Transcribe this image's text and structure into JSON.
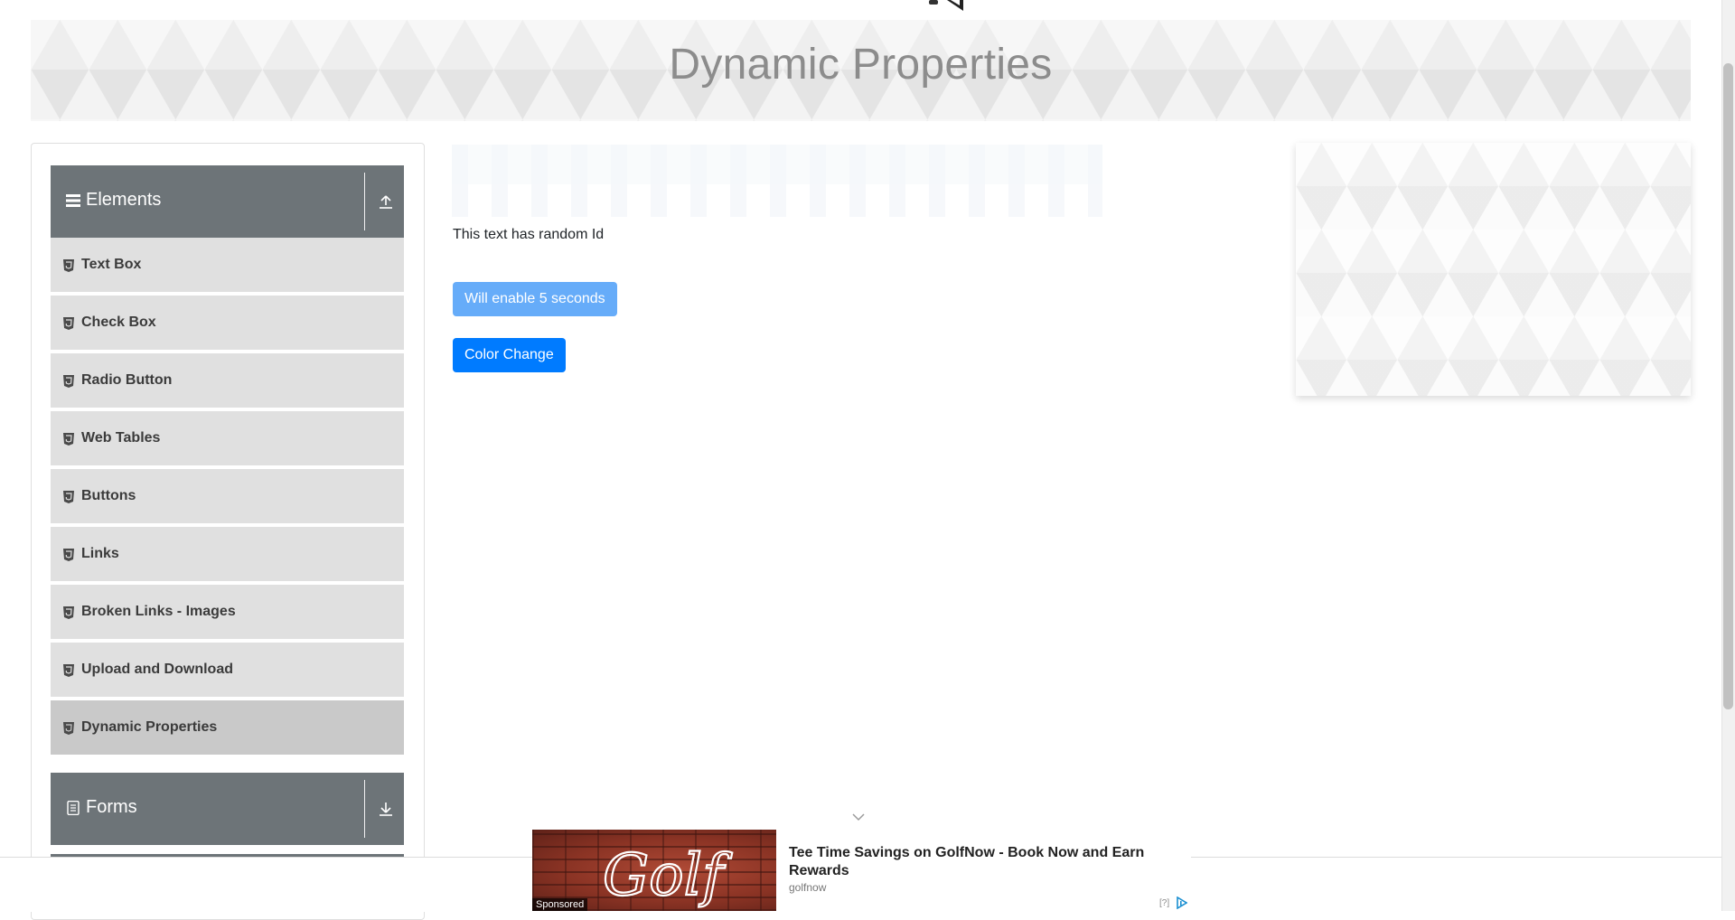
{
  "page": {
    "title": "Dynamic Properties"
  },
  "sidebar": {
    "groups": [
      {
        "label": "Elements",
        "icon": "hamburger-icon",
        "toggle_icon": "collapse-up-icon"
      },
      {
        "label": "Forms",
        "icon": "document-icon",
        "toggle_icon": "expand-down-icon"
      }
    ],
    "items": [
      {
        "label": "Text Box",
        "icon": "html5-icon"
      },
      {
        "label": "Check Box",
        "icon": "html5-icon"
      },
      {
        "label": "Radio Button",
        "icon": "html5-icon"
      },
      {
        "label": "Web Tables",
        "icon": "html5-icon"
      },
      {
        "label": "Buttons",
        "icon": "html5-icon"
      },
      {
        "label": "Links",
        "icon": "html5-icon"
      },
      {
        "label": "Broken Links - Images",
        "icon": "html5-icon"
      },
      {
        "label": "Upload and Download",
        "icon": "html5-icon"
      },
      {
        "label": "Dynamic Properties",
        "icon": "html5-icon",
        "active": true
      }
    ]
  },
  "main": {
    "random_id_text": "This text has random Id",
    "enable_button_label": "Will enable 5 seconds",
    "color_change_button_label": "Color Change"
  },
  "ad": {
    "title": "Tee Time Savings on GolfNow - Book Now and Earn Rewards",
    "source": "golfnow",
    "sponsored_label": "Sponsored",
    "info_label": "[?]",
    "image_text": "Golf"
  },
  "colors": {
    "group_header": "#6d7478",
    "menu_item": "#e0e0e0",
    "menu_item_active": "#c9c9c9",
    "primary_button": "#007bff",
    "disabled_button": "#66acf9",
    "title_text": "#8c8c8c"
  }
}
